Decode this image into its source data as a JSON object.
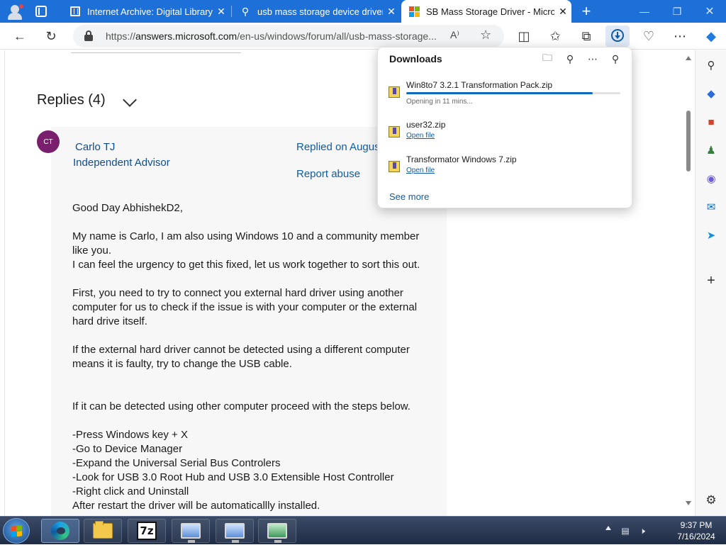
{
  "browser": {
    "tabs": [
      {
        "title": "Internet Archive: Digital Library",
        "favicon": "archive-icon"
      },
      {
        "title": "usb mass storage device driver",
        "favicon": "search-icon"
      },
      {
        "title": "SB Mass Storage Driver - Micro",
        "favicon": "microsoft-icon",
        "active": true
      }
    ],
    "url_host": "answers.microsoft.com",
    "url_prefix": "https://",
    "url_path": "/en-us/windows/forum/all/usb-mass-storage..."
  },
  "downloads": {
    "title": "Downloads",
    "items": [
      {
        "name": "Win8to7 3.2.1 Transformation Pack.zip",
        "status": "Opening in 11 mins...",
        "progress": 0.87
      },
      {
        "name": "user32.zip",
        "action": "Open file"
      },
      {
        "name": "Transformator Windows 7.zip",
        "action": "Open file"
      }
    ],
    "see_more": "See more"
  },
  "page": {
    "replies_title": "Replies (4)",
    "reply": {
      "avatar_initials": "CT",
      "author": "Carlo TJ",
      "role": "Independent Advisor",
      "replied_on": "Replied on Augus",
      "report": "Report abuse",
      "paragraphs": [
        "Good Day AbhishekD2,",
        "",
        "My name is Carlo, I am also using Windows 10 and a community member",
        "like you.",
        "I can feel the urgency to get this fixed, let us work together to sort this out.",
        "",
        "First, you need to try to connect you external hard driver using another",
        "computer for us to check if the issue is with your computer or the external",
        "hard drive itself.",
        "",
        "If the external hard driver cannot be detected using a different computer",
        "means it is faulty, try to change the USB cable.",
        "",
        "",
        "If it can be detected using other computer proceed with the steps below.",
        "",
        "-Press Windows key + X",
        "-Go to Device Manager",
        "-Expand the Universal Serial Bus Controlers",
        "-Look for USB 3.0 Root Hub and USB 3.0 Extensible Host Controller",
        "-Right click and Uninstall",
        "After restart the driver will be automaticallly installed."
      ]
    }
  },
  "taskbar": {
    "time": "9:37 PM",
    "date": "7/16/2024"
  },
  "colors": {
    "accent": "#1c70d8",
    "link": "#0f5ba6",
    "avatar": "#7a1f6e"
  }
}
